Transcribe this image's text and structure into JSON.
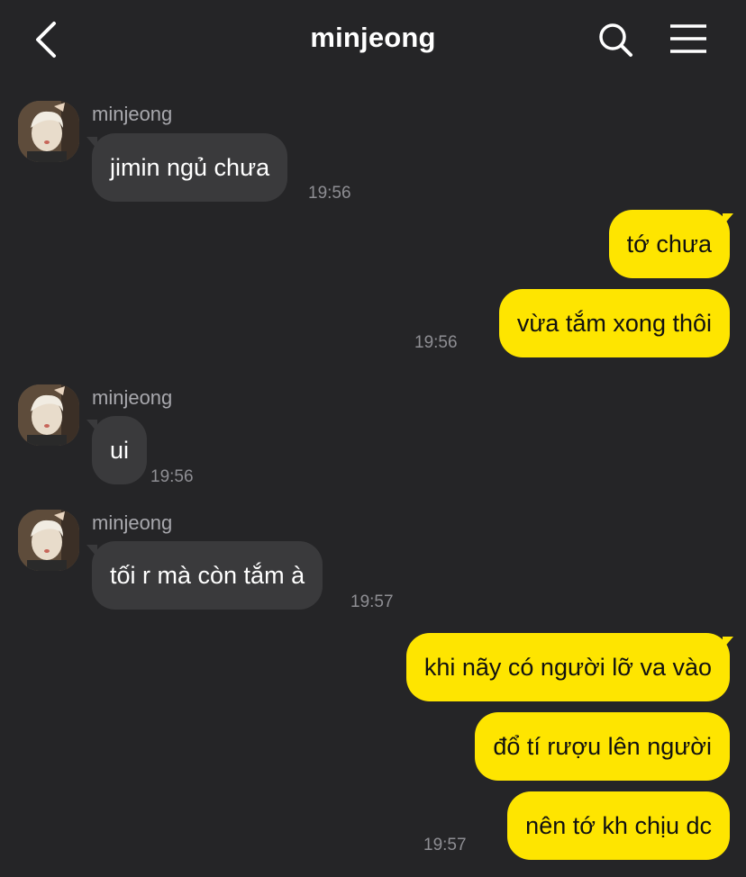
{
  "header": {
    "title": "minjeong",
    "back_icon": "chevron-left-icon",
    "search_icon": "search-icon",
    "menu_icon": "hamburger-menu-icon"
  },
  "colors": {
    "background": "#252527",
    "incoming_bubble": "#3a3a3c",
    "outgoing_bubble": "#fee500",
    "timestamp": "#8e8e93",
    "sender_name": "#a8a8ad"
  },
  "messages": [
    {
      "dir": "in",
      "sender": "minjeong",
      "text": "jimin ngủ chưa",
      "time": "19:56"
    },
    {
      "dir": "out",
      "text": "tớ chưa",
      "time": ""
    },
    {
      "dir": "out",
      "text": "vừa tắm xong thôi",
      "time": "19:56"
    },
    {
      "dir": "in",
      "sender": "minjeong",
      "text": "ui",
      "time": "19:56"
    },
    {
      "dir": "in",
      "sender": "minjeong",
      "text": "tối r mà còn tắm à",
      "time": "19:57"
    },
    {
      "dir": "out",
      "text": "khi nãy có người lỡ va vào",
      "time": ""
    },
    {
      "dir": "out",
      "text": "đổ tí rượu lên người",
      "time": ""
    },
    {
      "dir": "out",
      "text": "nên tớ kh chịu dc",
      "time": "19:57"
    }
  ]
}
